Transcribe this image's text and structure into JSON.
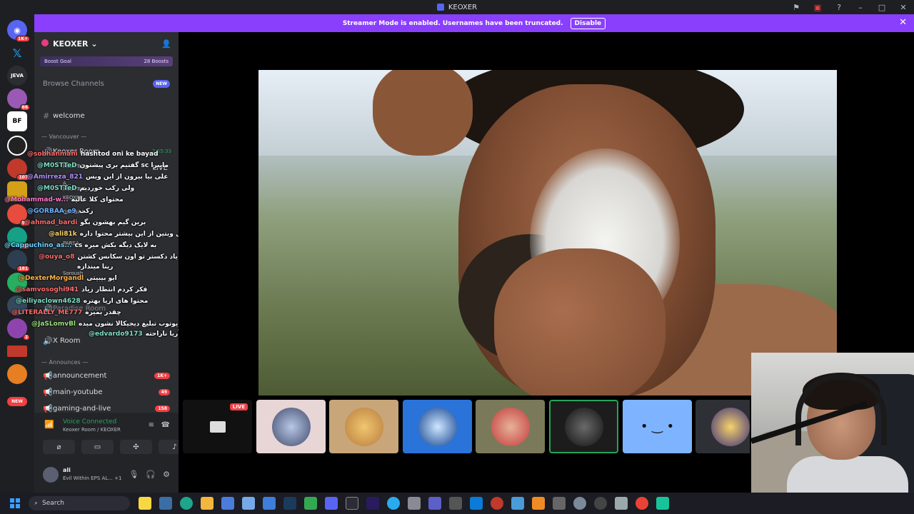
{
  "window": {
    "title": "KEOXER"
  },
  "banner": {
    "text": "Streamer Mode is enabled. Usernames have been truncated.",
    "button": "Disable"
  },
  "rail": {
    "badges": [
      "1K+",
      "66",
      "107",
      "97",
      "11",
      "181",
      "2"
    ],
    "labels": {
      "jeva": "JEVA",
      "bf": "BF"
    },
    "new_label": "NEW"
  },
  "server": {
    "name": "KEOXER",
    "boost_goal": "Boost Goal",
    "boosts": "28 Boosts",
    "browse": "Browse Channels",
    "new_tag": "NEW"
  },
  "channels": {
    "welcome": "welcome",
    "cat_vancouver": "Vancouver",
    "keoxer_room": "Keoxer Room",
    "keoxer_room_time": "2:55:33",
    "live": "LIVE",
    "voice_users": [
      "M0STTeD",
      "A...",
      "M0STTeD",
      "KEOXER",
      "GORBAA",
      "PARSA",
      "Soroush",
      "ASIN"
    ],
    "paradise_room": "Paradise Room",
    "x_room": "X Room",
    "cat_announces": "Announces",
    "announcement": "announcement",
    "announcement_badge": "1K+",
    "main_youtube": "main-youtube",
    "main_youtube_badge": "49",
    "gaming_live": "gaming-and-live",
    "gaming_live_badge": "158"
  },
  "chat": [
    {
      "user": "@sobhanmani",
      "msg": "hashtod oni ke bayad",
      "color": "#ff6b6b"
    },
    {
      "user": "@M0STTeD",
      "msg": "گفتیم بری پیشتون sc مایبرا",
      "color": "#7ee0c4"
    },
    {
      "user": "@Amirreza_821",
      "msg": "علی بیا بیرون از این ویس",
      "color": "#b48cff"
    },
    {
      "user": "@M0STTeD",
      "msg": "ولی رکب خوردیم",
      "color": "#7ee0c4"
    },
    {
      "user": "@Mohammad-w...",
      "msg": "محتوای کلا عالیه",
      "color": "#ff78c8"
    },
    {
      "user": "@GORBAA_e9",
      "msg": "رکب",
      "color": "#6fb1ff"
    },
    {
      "user": "@ahmad_bardi",
      "msg": "برین گیم بهشون بگو",
      "color": "#ff6b6b"
    },
    {
      "user": "@ali81k",
      "msg": "اوپل ویتین از این بیشتر محتوا داره",
      "color": "#ffd166"
    },
    {
      "user": "@Cappuchino_as...",
      "msg": "cs به لایک دیگه بکش میره",
      "color": "#6fd3ff"
    },
    {
      "user": "@ouya_o8",
      "msg": "علی اینجا منو یاد دکستر تو اون سکانس کشتن",
      "color": "#ff6b6b"
    },
    {
      "user": "",
      "msg": "رینا میندازه",
      "color": "#ffffff"
    },
    {
      "user": "@DexterMorgandl",
      "msg": "ایو بیبیتی",
      "color": "#ffb347"
    },
    {
      "user": "@samvosoghi941",
      "msg": "فکر کردم انتظار زیاد",
      "color": "#ff6b6b"
    },
    {
      "user": "@eiliyaclown4628",
      "msg": "محتوا های اریا بهتره",
      "color": "#7ee0c4"
    },
    {
      "user": "@LITERALLY_ME777",
      "msg": "چقدر بمیره",
      "color": "#ff6b6b"
    },
    {
      "user": "@JaSLomvBl",
      "msg": "علی برا من یوتوب تبلیغ دیجیکالا نشون میده",
      "color": "#9be37a"
    },
    {
      "user": "@edvardo9173",
      "msg": "آریا ناراحته",
      "color": "#7ee0c4"
    }
  ],
  "voice_panel": {
    "status": "Voice Connected",
    "location": "Keoxer Room / KEOXER"
  },
  "user_panel": {
    "name": "ali",
    "status": "Evil Within EPS AL...",
    "extra": "+1"
  },
  "tiles": {
    "live": "LIVE"
  },
  "taskbar": {
    "search_placeholder": "Search"
  },
  "colors": {
    "banner": "#8a3ffc",
    "accent": "#5865f2",
    "danger": "#f23f43",
    "connected": "#23a55a"
  }
}
